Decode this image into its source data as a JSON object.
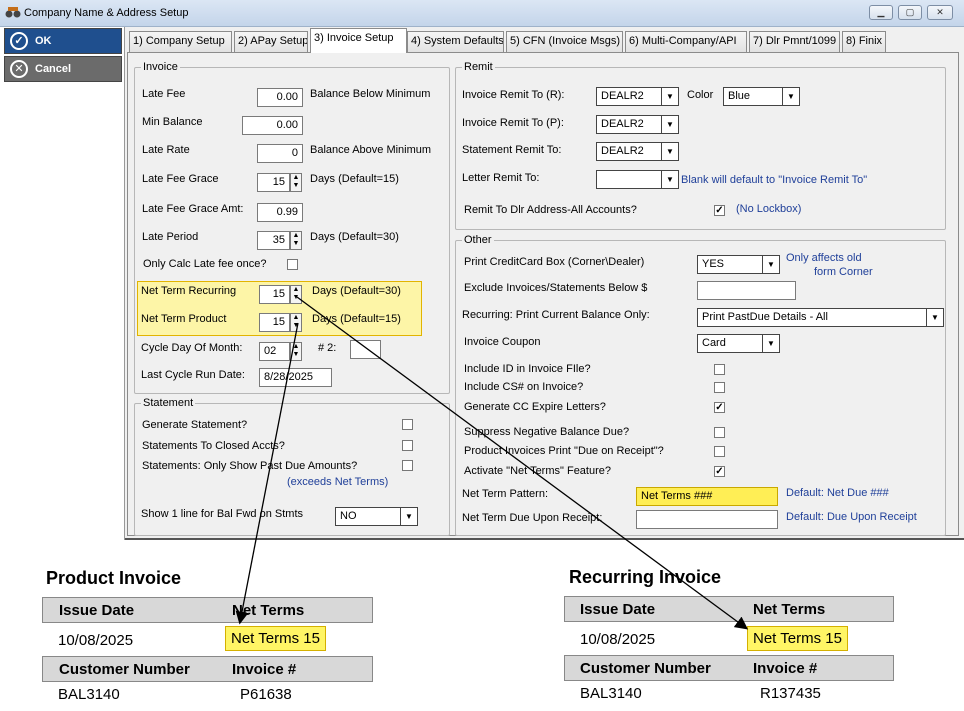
{
  "window": {
    "title": "Company Name & Address Setup",
    "min": "▁",
    "max": "▢",
    "close": "✕"
  },
  "actions": {
    "ok": "OK",
    "cancel": "Cancel"
  },
  "tabs": [
    {
      "label": "1) Company Setup"
    },
    {
      "label": "2) APay Setup"
    },
    {
      "label": "3) Invoice Setup"
    },
    {
      "label": "4) System Defaults"
    },
    {
      "label": "5) CFN (Invoice Msgs)"
    },
    {
      "label": "6) Multi-Company/API"
    },
    {
      "label": "7) Dlr Pmnt/1099"
    },
    {
      "label": "8) Finix"
    }
  ],
  "invoice": {
    "group": "Invoice",
    "late_fee": {
      "label": "Late Fee",
      "value": "0.00",
      "note": "Balance Below Minimum"
    },
    "min_balance": {
      "label": "Min Balance",
      "value": "0.00"
    },
    "late_rate": {
      "label": "Late Rate",
      "value": "0",
      "note": "Balance Above Minimum"
    },
    "grace": {
      "label": "Late Fee Grace",
      "value": "15",
      "note": "Days (Default=15)"
    },
    "grace_amt": {
      "label": "Late Fee Grace Amt:",
      "value": "0.99"
    },
    "late_period": {
      "label": "Late Period",
      "value": "35",
      "note": "Days (Default=30)"
    },
    "calc_once": {
      "label": "Only Calc Late fee once?",
      "checked": ""
    },
    "nt_recurring": {
      "label": "Net Term Recurring",
      "value": "15",
      "note": "Days (Default=30)"
    },
    "nt_product": {
      "label": "Net Term Product",
      "value": "15",
      "note": "Days (Default=15)"
    },
    "cycle_day": {
      "label": "Cycle Day Of Month:",
      "value": "02",
      "label2": "# 2:",
      "value2": ""
    },
    "last_cycle": {
      "label": "Last Cycle Run Date:",
      "value": "8/28/2025"
    }
  },
  "statement": {
    "group": "Statement",
    "generate": {
      "label": "Generate Statement?",
      "checked": ""
    },
    "closed": {
      "label": "Statements To Closed Accts?",
      "checked": ""
    },
    "past_due": {
      "label": "Statements: Only Show Past Due Amounts?",
      "checked": "",
      "hint": "(exceeds Net Terms)"
    },
    "bal_fwd": {
      "label": "Show 1 line for Bal Fwd on Stmts",
      "value": "NO"
    }
  },
  "remit": {
    "group": "Remit",
    "inv_r": {
      "label": "Invoice Remit To (R):",
      "value": "DEALR2",
      "color_label": "Color",
      "color": "Blue"
    },
    "inv_p": {
      "label": "Invoice Remit To (P):",
      "value": "DEALR2"
    },
    "stmt": {
      "label": "Statement Remit To:",
      "value": "DEALR2"
    },
    "letter": {
      "label": "Letter Remit To:",
      "value": "",
      "hint": "Blank will default to \"Invoice Remit To\""
    },
    "dlr": {
      "label": "Remit To Dlr Address-All Accounts?",
      "checked": "✓",
      "hint": "(No Lockbox)"
    }
  },
  "other": {
    "group": "Other",
    "cc_box": {
      "label": "Print CreditCard Box (Corner\\Dealer)",
      "value": "YES",
      "hint1": "Only affects old",
      "hint2": "form Corner"
    },
    "exclude": {
      "label": "Exclude Invoices/Statements Below $",
      "value": ""
    },
    "recurring_bal": {
      "label": "Recurring: Print Current Balance Only:",
      "value": "Print PastDue Details - All"
    },
    "coupon": {
      "label": "Invoice Coupon",
      "value": "Card"
    },
    "include_id": {
      "label": "Include ID in Invoice FIle?",
      "checked": ""
    },
    "include_cs": {
      "label": "Include CS# on Invoice?",
      "checked": ""
    },
    "cc_expire": {
      "label": "Generate CC Expire Letters?",
      "checked": "✓"
    },
    "suppress": {
      "label": "Suppress Negative Balance Due?",
      "checked": ""
    },
    "due_receipt": {
      "label": "Product Invoices Print \"Due on Receipt\"?",
      "checked": ""
    },
    "activate_nt": {
      "label": "Activate  \"Net Terms\" Feature?",
      "checked": "✓"
    },
    "nt_pattern": {
      "label": "Net Term Pattern:",
      "value": "Net Terms ###",
      "hint": "Default: Net Due ###"
    },
    "nt_due": {
      "label": "Net Term Due Upon Receipt:",
      "value": "",
      "hint": "Default: Due Upon Receipt"
    }
  },
  "product_invoice": {
    "title": "Product Invoice",
    "issue_label": "Issue Date",
    "terms_label": "Net Terms",
    "issue_date": "10/08/2025",
    "terms": "Net Terms 15",
    "cust_label": "Customer Number",
    "inv_label": "Invoice #",
    "customer": "BAL3140",
    "invoice": "P61638"
  },
  "recurring_invoice": {
    "title": "Recurring Invoice",
    "issue_label": "Issue Date",
    "terms_label": "Net Terms",
    "issue_date": "10/08/2025",
    "terms": "Net Terms 15",
    "cust_label": "Customer Number",
    "inv_label": "Invoice #",
    "customer": "BAL3140",
    "invoice": "R137435"
  },
  "colors": {
    "ok_button": "#1f4f8e",
    "cancel_button": "#6b6b6b",
    "highlight": "#fdf5a7",
    "hint": "#1f3f99",
    "net_terms_fill": "#fff565"
  }
}
